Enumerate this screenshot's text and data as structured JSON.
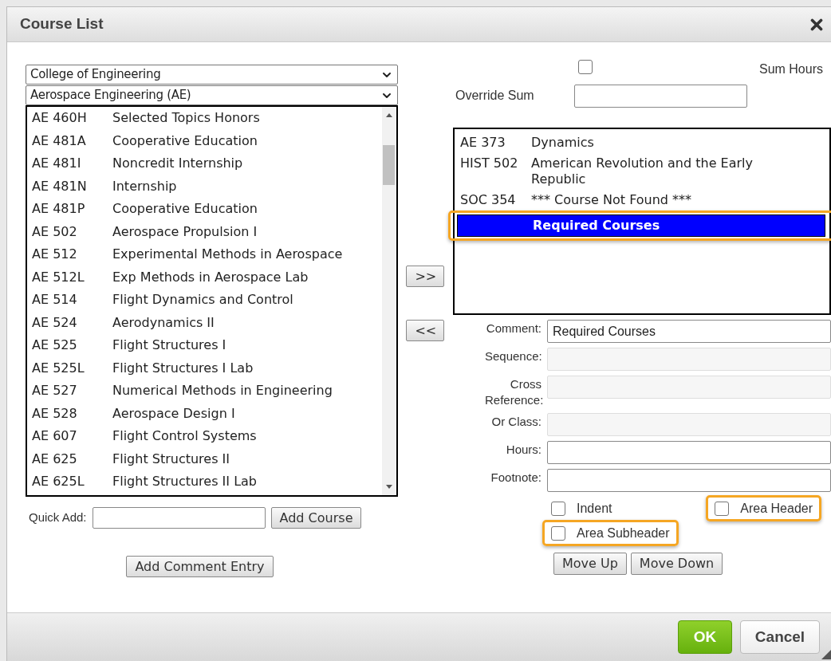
{
  "window": {
    "title": "Course List"
  },
  "college_select": {
    "value": "College of Engineering"
  },
  "department_select": {
    "value": "Aerospace Engineering (AE)"
  },
  "available_courses": [
    {
      "code": "AE 460H",
      "title": "Selected Topics Honors"
    },
    {
      "code": "AE 481A",
      "title": "Cooperative Education"
    },
    {
      "code": "AE 481I",
      "title": "Noncredit Internship"
    },
    {
      "code": "AE 481N",
      "title": "Internship"
    },
    {
      "code": "AE 481P",
      "title": "Cooperative Education"
    },
    {
      "code": "AE 502",
      "title": "Aerospace Propulsion I"
    },
    {
      "code": "AE 512",
      "title": "Experimental Methods in Aerospace"
    },
    {
      "code": "AE 512L",
      "title": "Exp Methods in Aerospace Lab"
    },
    {
      "code": "AE 514",
      "title": "Flight Dynamics and Control"
    },
    {
      "code": "AE 524",
      "title": "Aerodynamics II"
    },
    {
      "code": "AE 525",
      "title": "Flight Structures I"
    },
    {
      "code": "AE 525L",
      "title": "Flight Structures I Lab"
    },
    {
      "code": "AE 527",
      "title": "Numerical Methods in Engineering"
    },
    {
      "code": "AE 528",
      "title": "Aerospace Design I"
    },
    {
      "code": "AE 607",
      "title": "Flight Control Systems"
    },
    {
      "code": "AE 625",
      "title": "Flight Structures II"
    },
    {
      "code": "AE 625L",
      "title": "Flight Structures II Lab"
    }
  ],
  "quick_add": {
    "label": "Quick Add:",
    "button": "Add Course"
  },
  "add_comment_button": "Add Comment Entry",
  "add_button": ">>",
  "remove_button": "<<",
  "sum_hours": {
    "label": "Sum Hours",
    "checked": false
  },
  "override_sum": {
    "label": "Override Sum"
  },
  "selected_courses": [
    {
      "code": "AE 373",
      "title": "Dynamics",
      "selected": false,
      "highlighted": false
    },
    {
      "code": "HIST 502",
      "title": "American Revolution and the Early Republic",
      "selected": false,
      "highlighted": false
    },
    {
      "code": "SOC 354",
      "title": "*** Course Not Found ***",
      "selected": false,
      "highlighted": false
    },
    {
      "title": "Required Courses",
      "selected": true,
      "highlighted": true
    }
  ],
  "fields": [
    {
      "label": "Comment:",
      "value": "Required Courses",
      "disabled": false
    },
    {
      "label": "Sequence:",
      "disabled": true
    },
    {
      "label": "Cross Reference:",
      "disabled": true
    },
    {
      "label": "Or Class:",
      "disabled": true
    },
    {
      "label": "Hours:",
      "disabled": false
    },
    {
      "label": "Footnote:",
      "disabled": false
    }
  ],
  "checkboxes": [
    {
      "label": "Indent",
      "checked": false,
      "highlighted": false
    },
    {
      "label": "Area Header",
      "checked": false,
      "highlighted": true
    },
    {
      "label": "Area Subheader",
      "checked": false,
      "highlighted": true
    }
  ],
  "move_buttons": [
    "Move Up",
    "Move Down"
  ],
  "footer": {
    "ok": "OK",
    "cancel": "Cancel"
  }
}
